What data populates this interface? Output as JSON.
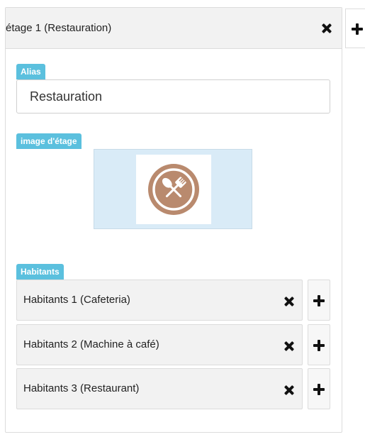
{
  "floor_panel": {
    "title": "étage 1 (Restauration)",
    "alias_tag": "Alias",
    "alias_value": "Restauration",
    "image_tag": "image d'étage",
    "image_icon": "restaurant-fork-spoon-icon",
    "habitants_tag": "Habitants",
    "habitants": [
      {
        "label": "Habitants 1 (Cafeteria)"
      },
      {
        "label": "Habitants 2 (Machine à café)"
      },
      {
        "label": "Habitants 3 (Restaurant)"
      }
    ]
  },
  "colors": {
    "tag_bg": "#5bc0de",
    "header_bg": "#f2f2f2",
    "image_bg": "#d9ebf7",
    "icon_circle": "#b98a6e"
  }
}
